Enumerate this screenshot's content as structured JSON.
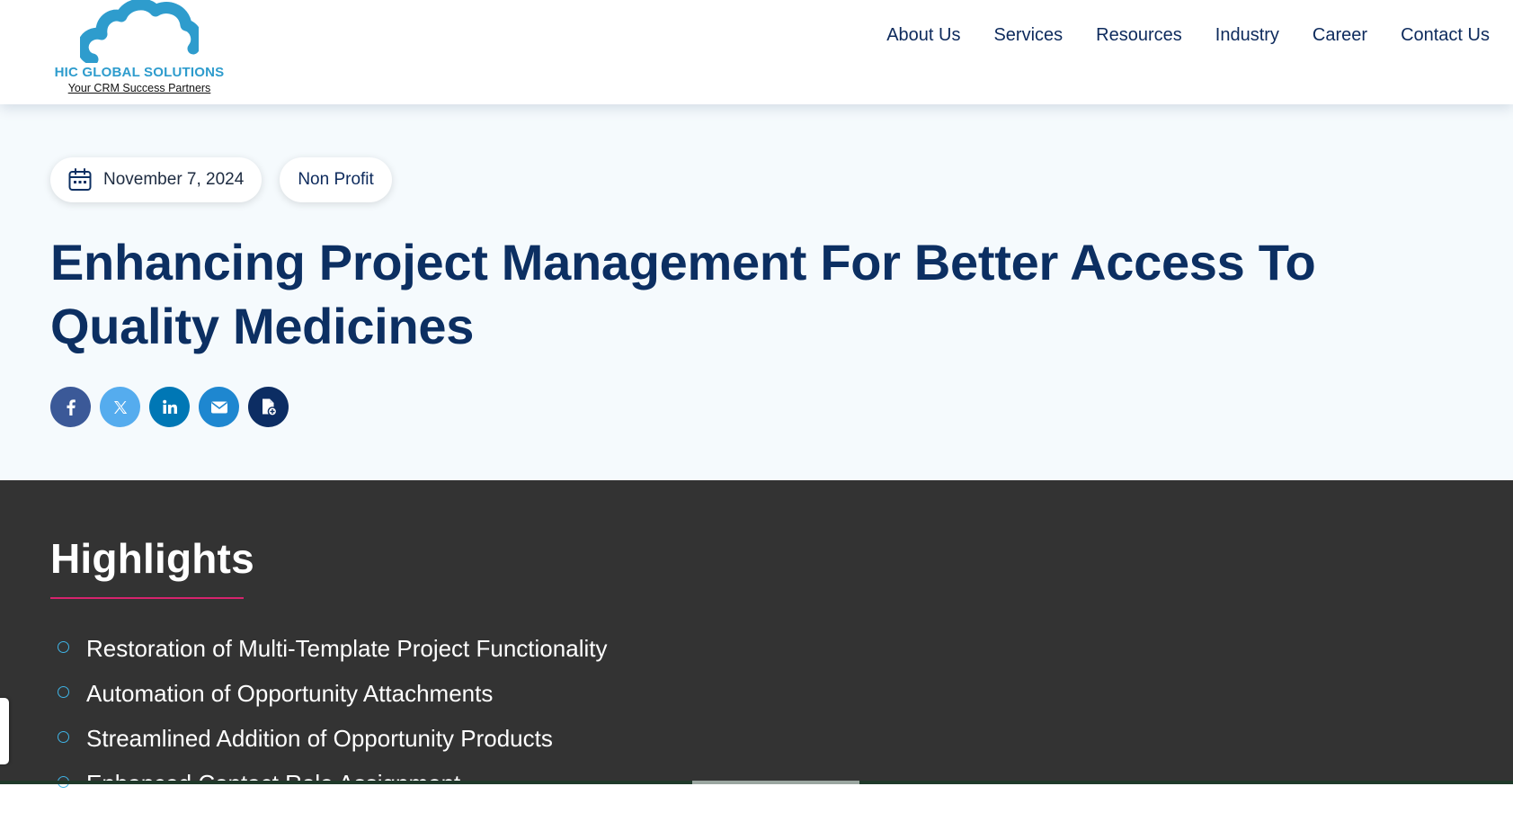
{
  "brand": {
    "name": "HIC GLOBAL SOLUTIONS",
    "tagline": "Your CRM Success Partners",
    "color": "#2e9ccd"
  },
  "nav": {
    "items": [
      {
        "label": "About Us"
      },
      {
        "label": "Services"
      },
      {
        "label": "Resources"
      },
      {
        "label": "Industry"
      },
      {
        "label": "Career"
      },
      {
        "label": "Contact Us"
      }
    ]
  },
  "post": {
    "date": "November 7, 2024",
    "date_icon": "calendar-icon",
    "category": "Non Profit",
    "title": "Enhancing Project Management For Better Access To Quality Medicines"
  },
  "share": {
    "buttons": [
      {
        "network": "facebook",
        "icon": "facebook-icon",
        "color": "#3b5998"
      },
      {
        "network": "x",
        "icon": "x-icon",
        "color": "#55acee"
      },
      {
        "network": "linkedin",
        "icon": "linkedin-icon",
        "color": "#0077b5"
      },
      {
        "network": "email",
        "icon": "email-icon",
        "color": "#1e87d0"
      },
      {
        "network": "save-pdf",
        "icon": "pdf-icon",
        "color": "#0c2d63"
      }
    ]
  },
  "highlights": {
    "title": "Highlights",
    "accent_color": "#d6246e",
    "bullet_color": "#3fb4e6",
    "items": [
      "Restoration of Multi-Template Project Functionality",
      "Automation of Opportunity Attachments",
      "Streamlined Addition of Opportunity Products",
      "Enhanced Contact Role Assignment"
    ]
  }
}
